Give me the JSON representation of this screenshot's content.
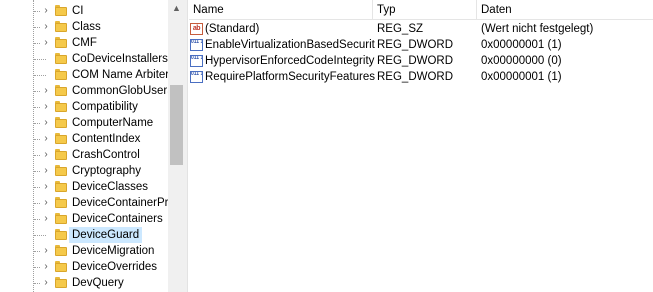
{
  "tree": {
    "items": [
      {
        "label": "CI",
        "expandable": true,
        "selected": false
      },
      {
        "label": "Class",
        "expandable": true,
        "selected": false
      },
      {
        "label": "CMF",
        "expandable": true,
        "selected": false
      },
      {
        "label": "CoDeviceInstallers",
        "expandable": false,
        "selected": false
      },
      {
        "label": "COM Name Arbiter",
        "expandable": false,
        "selected": false
      },
      {
        "label": "CommonGlobUserSe",
        "expandable": true,
        "selected": false
      },
      {
        "label": "Compatibility",
        "expandable": true,
        "selected": false
      },
      {
        "label": "ComputerName",
        "expandable": true,
        "selected": false
      },
      {
        "label": "ContentIndex",
        "expandable": true,
        "selected": false
      },
      {
        "label": "CrashControl",
        "expandable": true,
        "selected": false
      },
      {
        "label": "Cryptography",
        "expandable": true,
        "selected": false
      },
      {
        "label": "DeviceClasses",
        "expandable": true,
        "selected": false
      },
      {
        "label": "DeviceContainerProp",
        "expandable": true,
        "selected": false
      },
      {
        "label": "DeviceContainers",
        "expandable": true,
        "selected": false
      },
      {
        "label": "DeviceGuard",
        "expandable": false,
        "selected": true
      },
      {
        "label": "DeviceMigration",
        "expandable": true,
        "selected": false
      },
      {
        "label": "DeviceOverrides",
        "expandable": true,
        "selected": false
      },
      {
        "label": "DevQuery",
        "expandable": true,
        "selected": false
      }
    ],
    "expand_glyph": "›",
    "folder_icon": "folder-icon"
  },
  "scrollbar": {
    "up_glyph": "▲"
  },
  "list": {
    "headers": {
      "name": "Name",
      "type": "Typ",
      "data": "Daten"
    },
    "rows": [
      {
        "icon": "string-value-icon",
        "icon_text": "ab",
        "name": "(Standard)",
        "type": "REG_SZ",
        "data": "(Wert nicht festgelegt)"
      },
      {
        "icon": "dword-value-icon",
        "icon_text": "011 110",
        "name": "EnableVirtualizationBasedSecurity",
        "type": "REG_DWORD",
        "data": "0x00000001 (1)"
      },
      {
        "icon": "dword-value-icon",
        "icon_text": "011 110",
        "name": "HypervisorEnforcedCodeIntegrity",
        "type": "REG_DWORD",
        "data": "0x00000000 (0)"
      },
      {
        "icon": "dword-value-icon",
        "icon_text": "011 110",
        "name": "RequirePlatformSecurityFeatures",
        "type": "REG_DWORD",
        "data": "0x00000001 (1)"
      }
    ]
  }
}
